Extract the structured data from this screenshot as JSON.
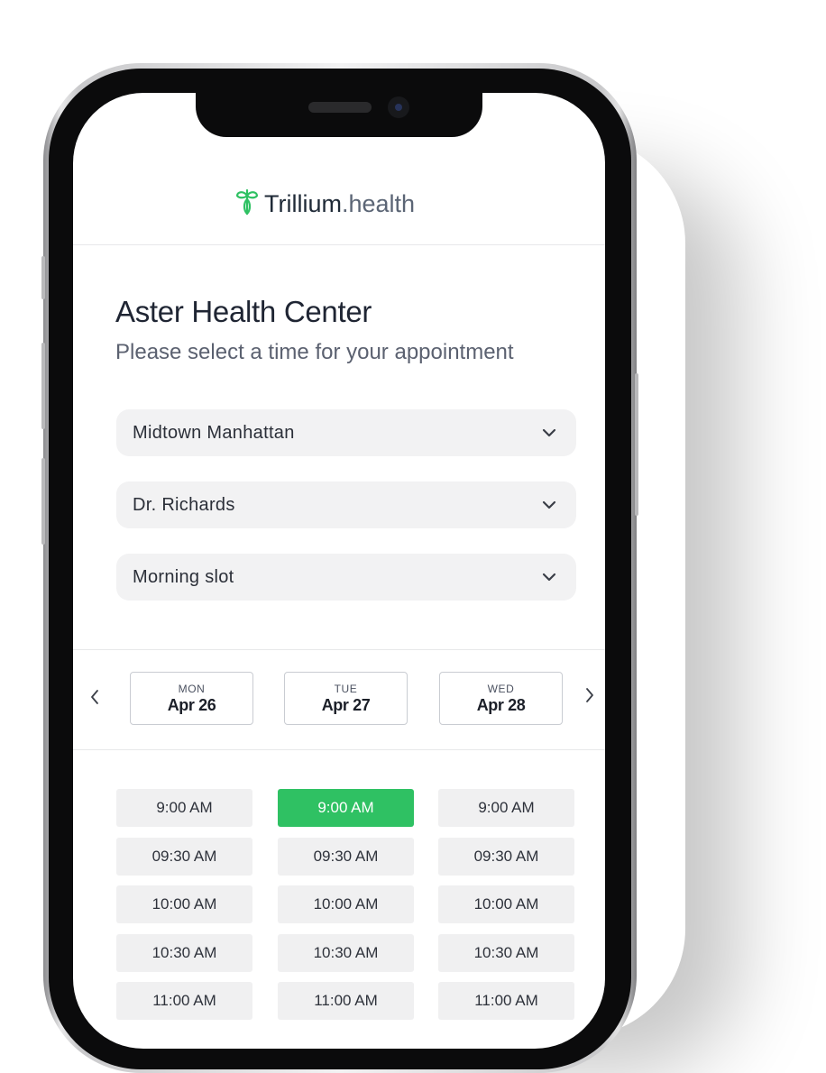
{
  "brand": {
    "name": "Trillium",
    "domain": ".health",
    "accent": "#2fc163"
  },
  "header": {
    "title": "Aster Health Center",
    "subtitle": "Please select a time for your appointment"
  },
  "selects": {
    "location": "Midtown Manhattan",
    "doctor": "Dr. Richards",
    "slot_type": "Morning slot"
  },
  "days": [
    {
      "dow": "MON",
      "date": "Apr 26"
    },
    {
      "dow": "TUE",
      "date": "Apr 27"
    },
    {
      "dow": "WED",
      "date": "Apr 28"
    }
  ],
  "times": {
    "mon": [
      "9:00 AM",
      "09:30 AM",
      "10:00 AM",
      "10:30 AM",
      "11:00 AM"
    ],
    "tue": [
      "9:00 AM",
      "09:30 AM",
      "10:00 AM",
      "10:30 AM",
      "11:00 AM"
    ],
    "wed": [
      "9:00 AM",
      "09:30 AM",
      "10:00 AM",
      "10:30 AM",
      "11:00 AM"
    ]
  },
  "selected_slot": {
    "day": "tue",
    "time": "9:00 AM"
  },
  "icons": {
    "logo": "trillium-flower-icon",
    "dropdown": "chevron-down-icon",
    "prev": "chevron-left-icon",
    "next": "chevron-right-icon"
  }
}
